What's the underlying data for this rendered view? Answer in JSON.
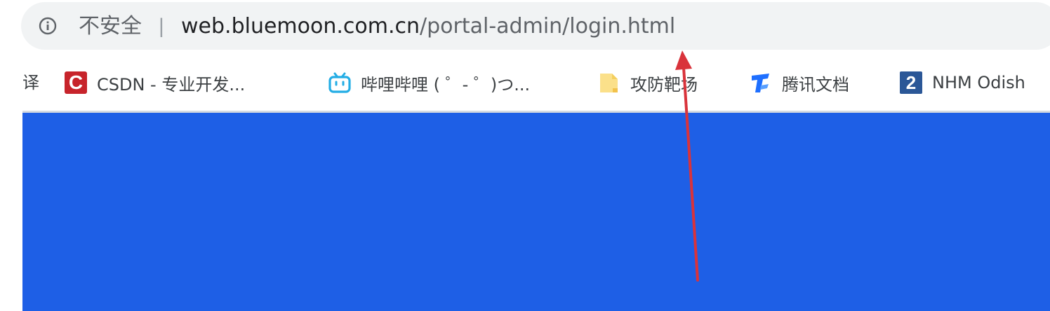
{
  "address_bar": {
    "security_label": "不安全",
    "separator": "|",
    "url_host": "web.bluemoon.com.cn",
    "url_path": "/portal-admin/login.html",
    "info_icon": "info-circle-icon"
  },
  "bookmarks_bar": {
    "cut_off_start": "译",
    "items": [
      {
        "label": "CSDN - 专业开发...",
        "icon": "csdn-logo-icon",
        "icon_text": "C"
      },
      {
        "label": "哔哩哔哩 ( ゜- ゜)つ...",
        "icon": "bilibili-tv-icon"
      },
      {
        "label": "攻防靶场",
        "icon": "folder-icon"
      },
      {
        "label": "腾讯文档",
        "icon": "tencent-docs-icon"
      },
      {
        "label": "NHM Odish",
        "icon": "numbered-2-icon",
        "icon_text": "2"
      }
    ]
  },
  "page": {
    "background_color": "#1e5fe6"
  },
  "annotation": {
    "arrow_color": "#d9333b"
  }
}
